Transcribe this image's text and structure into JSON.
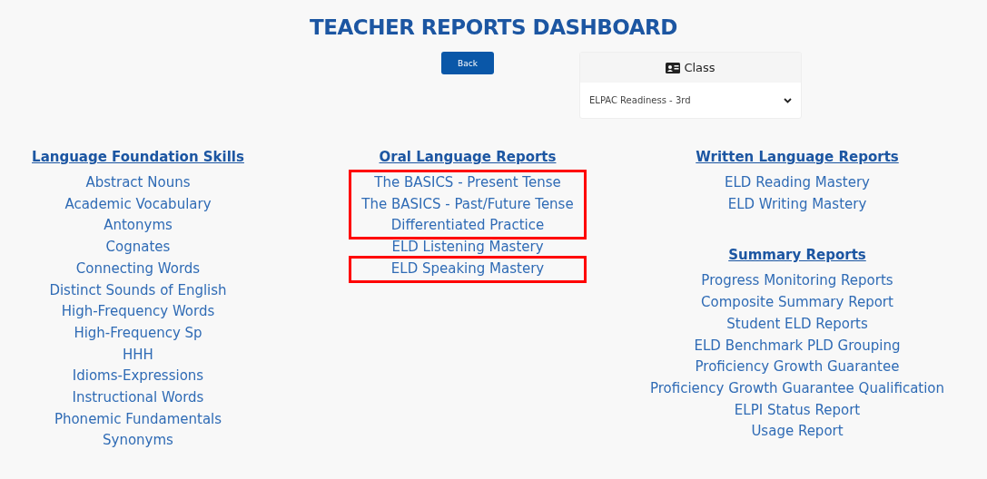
{
  "title": "TEACHER REPORTS DASHBOARD",
  "back_button": "Back",
  "class_selector": {
    "label": "Class",
    "value": "ELPAC Readiness - 3rd"
  },
  "columns": [
    {
      "sections": [
        {
          "title": "Language Foundation Skills",
          "groups": [
            {
              "highlighted": false,
              "items": [
                "Abstract Nouns",
                "Academic Vocabulary",
                "Antonyms",
                "Cognates",
                "Connecting Words",
                "Distinct Sounds of English",
                "High-Frequency Words",
                "High-Frequency Sp",
                "HHH",
                "Idioms-Expressions",
                "Instructional Words",
                "Phonemic Fundamentals",
                "Synonyms"
              ]
            }
          ]
        }
      ]
    },
    {
      "sections": [
        {
          "title": "Oral Language Reports",
          "groups": [
            {
              "highlighted": true,
              "items": [
                "The BASICS - Present Tense",
                "The BASICS - Past/Future Tense",
                "Differentiated Practice"
              ]
            },
            {
              "highlighted": false,
              "items": [
                "ELD Listening Mastery"
              ]
            },
            {
              "highlighted": true,
              "items": [
                "ELD Speaking Mastery"
              ]
            }
          ]
        }
      ]
    },
    {
      "sections": [
        {
          "title": "Written Language Reports",
          "groups": [
            {
              "highlighted": false,
              "items": [
                "ELD Reading Mastery",
                "ELD Writing Mastery"
              ]
            }
          ]
        },
        {
          "title": "Summary Reports",
          "groups": [
            {
              "highlighted": false,
              "items": [
                "Progress Monitoring Reports",
                "Composite Summary Report",
                "Student ELD Reports",
                "ELD Benchmark PLD Grouping",
                "Proficiency Growth Guarantee",
                "Proficiency Growth Guarantee Qualification",
                "ELPI Status Report",
                "Usage Report"
              ]
            }
          ]
        }
      ]
    }
  ]
}
